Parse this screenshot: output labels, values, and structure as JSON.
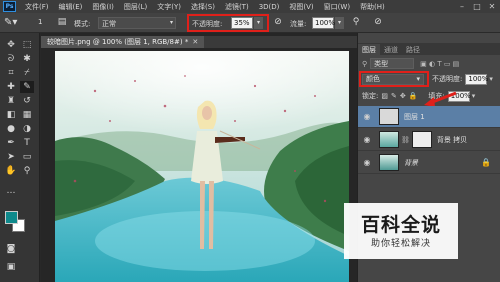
{
  "menubar": {
    "logo": "Ps",
    "items": [
      "文件(F)",
      "编辑(E)",
      "图像(I)",
      "图层(L)",
      "文字(Y)",
      "选择(S)",
      "滤镜(T)",
      "3D(D)",
      "视图(V)",
      "窗口(W)",
      "帮助(H)"
    ]
  },
  "options": {
    "brush_size": "1",
    "mode_label": "模式:",
    "mode_value": "正常",
    "opacity_label": "不透明度:",
    "opacity_value": "35%",
    "flow_label": "流量:",
    "flow_value": "100%"
  },
  "document": {
    "tab_title": "较暗图片.png @ 100% (图层 1, RGB/8#) *"
  },
  "layers_panel": {
    "tabs": [
      "图层",
      "通道",
      "路径"
    ],
    "filter_label": "类型",
    "blend_mode": "颜色",
    "opacity_label": "不透明度:",
    "opacity_value": "100%",
    "lock_label": "锁定:",
    "fill_label": "填充:",
    "fill_value": "100%",
    "layers": [
      {
        "name": "图层 1"
      },
      {
        "name": "背景 拷贝"
      },
      {
        "name": "背景"
      }
    ]
  },
  "colors": {
    "foreground": "#0f8a8c",
    "background": "#ffffff",
    "highlight": "#e0201a"
  },
  "watermark": {
    "title": "百科全说",
    "subtitle": "助你轻松解决"
  }
}
